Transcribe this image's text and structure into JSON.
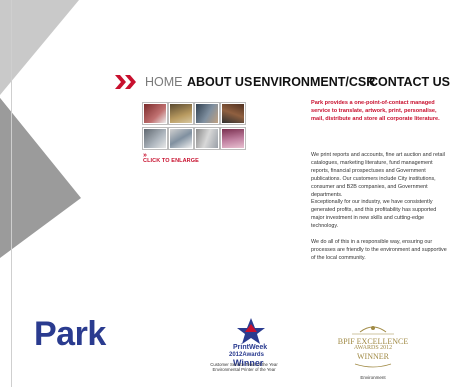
{
  "nav": {
    "arrows_icon": "double-chevron-right-icon",
    "items": [
      {
        "label": "HOME"
      },
      {
        "label": "ABOUT US"
      },
      {
        "label": "ENVIRONMENT/CSR"
      },
      {
        "label": "CONTACT US"
      }
    ]
  },
  "gallery": {
    "arrows": "»",
    "enlarge_label": "CLICK TO ENLARGE"
  },
  "content": {
    "intro": "Park provides a one-point-of-contact managed service to translate, artwork, print, personalise, mail, distribute and store all corporate literature.",
    "p1": "We print reports and accounts, fine art auction and retail catalogues, marketing literature, fund management reports, financial prospectuses and Government publications. Our customers include City institutions, consumer and B2B companies, and Government departments.",
    "p2": "Exceptionally for our industry, we have consistently generated profits, and this profitability has supported major investment in new skills and cutting-edge technology.",
    "p3": "We do all of this in a responsible way, ensuring our processes are friendly to the environment and supportive of the local community."
  },
  "logos": {
    "park": "Park",
    "printweek_line1": "PrintWeek",
    "printweek_line2": "2012Awards",
    "printweek_winner": "Winner",
    "printweek_caption1": "Customer Service Team of the Year",
    "printweek_caption2": "Environmental Printer of the Year",
    "bpif_line1": "BPIF EXCELLENCE",
    "bpif_line2": "AWARDS 2012",
    "bpif_line3": "WINNER",
    "bpif_caption": "Environment"
  },
  "colors": {
    "accent_red": "#c8102e",
    "park_blue": "#2a3b8f",
    "gray_shape": "#9b9b9b",
    "gold": "#a08a45"
  }
}
